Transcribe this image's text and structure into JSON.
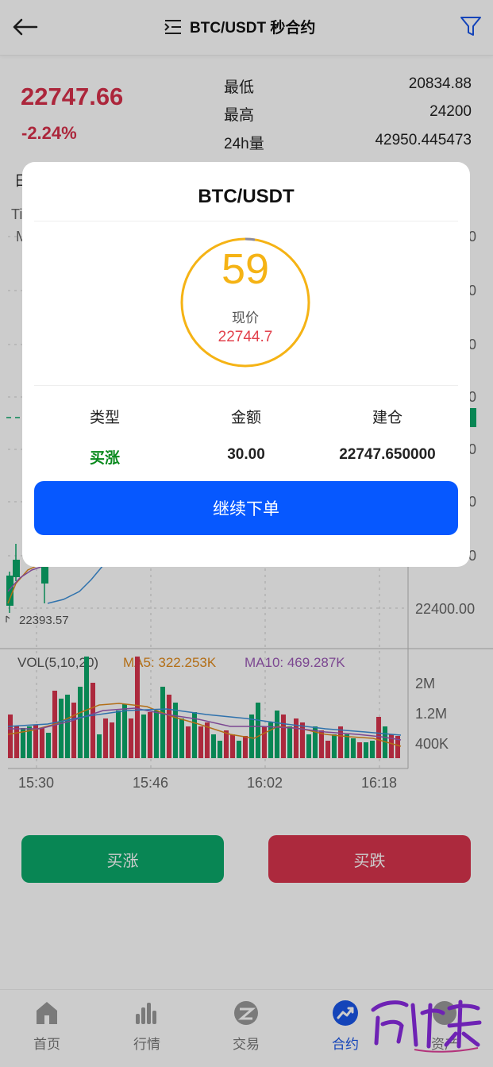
{
  "header": {
    "title": "BTC/USDT 秒合约"
  },
  "market": {
    "price": "22747.66",
    "change": "-2.24%",
    "low_label": "最低",
    "low_value": "20834.88",
    "high_label": "最高",
    "high_value": "24200",
    "volume_label": "24h量",
    "volume_value": "42950.445473"
  },
  "chart": {
    "price_axis": [
      "22400.00"
    ],
    "low_marker": "22393.57",
    "vol_legend": {
      "vol": "VOL(5,10,20)",
      "ma5": "MA5: 322.253K",
      "ma10": "MA10: 469.287K"
    },
    "vol_axis": [
      "2M",
      "1.2M",
      "400K"
    ],
    "time_axis": [
      "15:30",
      "15:46",
      "16:02",
      "16:18"
    ],
    "partial_labels": {
      "left_a": "Ti",
      "left_b": "M",
      "left_c": "日"
    },
    "colors": {
      "up": "#0aa86a",
      "down": "#d8344d",
      "ma5": "#e08a1c",
      "ma10": "#9b59b6",
      "ma20": "#3b8fd9"
    }
  },
  "buttons": {
    "buy_up": "买涨",
    "buy_down": "买跌"
  },
  "nav": {
    "items": [
      {
        "label": "首页",
        "icon": "home-icon"
      },
      {
        "label": "行情",
        "icon": "market-icon"
      },
      {
        "label": "交易",
        "icon": "trade-icon"
      },
      {
        "label": "合约",
        "icon": "contract-icon",
        "active": true
      },
      {
        "label": "资产",
        "icon": "assets-icon"
      }
    ]
  },
  "modal": {
    "title": "BTC/USDT",
    "countdown": "59",
    "current_label": "现价",
    "current_value": "22744.7",
    "type_label": "类型",
    "type_value": "买涨",
    "amount_label": "金额",
    "amount_value": "30.00",
    "open_label": "建仓",
    "open_value": "22747.650000",
    "continue_label": "继续下单"
  }
}
